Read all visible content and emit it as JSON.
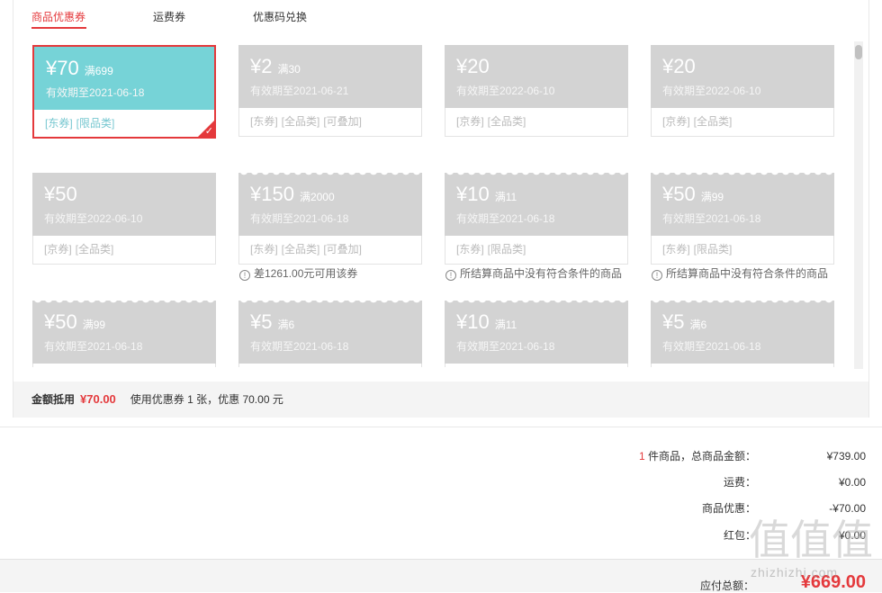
{
  "tabs": [
    {
      "label": "商品优惠券",
      "active": true
    },
    {
      "label": "运费券",
      "active": false
    },
    {
      "label": "优惠码兑换",
      "active": false
    }
  ],
  "coupons": [
    {
      "amount": "¥70",
      "condition": "满699",
      "expiry": "有效期至2021-06-18",
      "tags": [
        "[东券]",
        "[限品类]"
      ],
      "selected": true
    },
    {
      "amount": "¥2",
      "condition": "满30",
      "expiry": "有效期至2021-06-21",
      "tags": [
        "[东券]",
        "[全品类]",
        "[可叠加]"
      ],
      "selected": false
    },
    {
      "amount": "¥20",
      "condition": "",
      "expiry": "有效期至2022-06-10",
      "tags": [
        "[京券]",
        "[全品类]"
      ],
      "selected": false
    },
    {
      "amount": "¥20",
      "condition": "",
      "expiry": "有效期至2022-06-10",
      "tags": [
        "[京券]",
        "[全品类]"
      ],
      "selected": false
    },
    {
      "amount": "¥50",
      "condition": "",
      "expiry": "有效期至2022-06-10",
      "tags": [
        "[京券]",
        "[全品类]"
      ],
      "selected": false
    },
    {
      "amount": "¥150",
      "condition": "满2000",
      "expiry": "有效期至2021-06-18",
      "tags": [
        "[东券]",
        "[全品类]",
        "[可叠加]"
      ],
      "note": "差1261.00元可用该券",
      "selected": false
    },
    {
      "amount": "¥10",
      "condition": "满11",
      "expiry": "有效期至2021-06-18",
      "tags": [
        "[东券]",
        "[限品类]"
      ],
      "note": "所结算商品中没有符合条件的商品",
      "selected": false
    },
    {
      "amount": "¥50",
      "condition": "满99",
      "expiry": "有效期至2021-06-18",
      "tags": [
        "[东券]",
        "[限品类]"
      ],
      "note": "所结算商品中没有符合条件的商品",
      "selected": false
    },
    {
      "amount": "¥50",
      "condition": "满99",
      "expiry": "有效期至2021-06-18",
      "tags": [],
      "selected": false
    },
    {
      "amount": "¥5",
      "condition": "满6",
      "expiry": "有效期至2021-06-18",
      "tags": [],
      "selected": false
    },
    {
      "amount": "¥10",
      "condition": "满11",
      "expiry": "有效期至2021-06-18",
      "tags": [],
      "selected": false
    },
    {
      "amount": "¥5",
      "condition": "满6",
      "expiry": "有效期至2021-06-18",
      "tags": [],
      "selected": false
    }
  ],
  "panel_footer": {
    "label": "金额抵用",
    "amount": "¥70.00",
    "text": "使用优惠券 1 张，优惠 70.00 元"
  },
  "summary": {
    "count": "1",
    "items_label": "件商品，总商品金额：",
    "items_value": "¥739.00",
    "shipping_label": "运费：",
    "shipping_value": "¥0.00",
    "discount_label": "商品优惠：",
    "discount_value": "-¥70.00",
    "redpacket_label": "红包：",
    "redpacket_value": "¥0.00",
    "total_label": "应付总额：",
    "total_value": "¥669.00"
  },
  "watermark": {
    "text": "zhizhizhi.com",
    "glyph": "值"
  },
  "colors": {
    "accent": "#e4393c",
    "selected_coupon": "#76d3d7",
    "disabled_coupon": "#d3d3d3"
  }
}
